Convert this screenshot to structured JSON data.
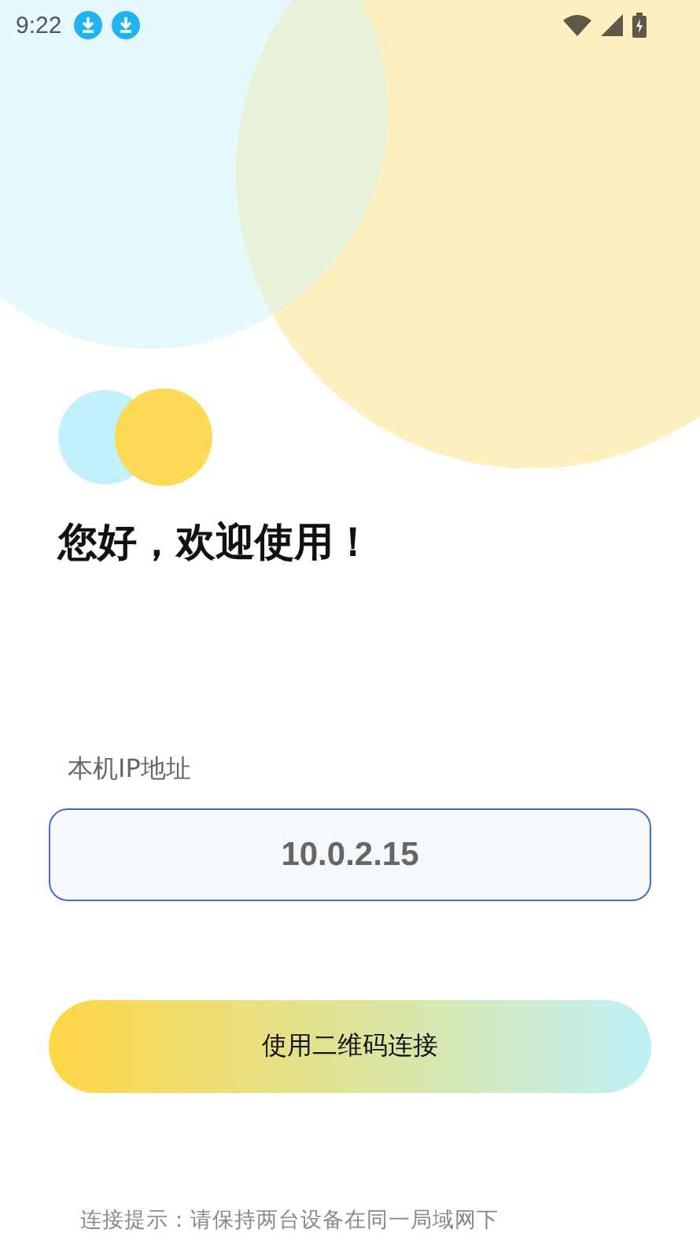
{
  "status_bar": {
    "time": "9:22",
    "notifications": [
      {
        "kind": "download"
      },
      {
        "kind": "download"
      }
    ]
  },
  "greeting": "您好，欢迎使用！",
  "ip_field": {
    "label": "本机IP地址",
    "value": "10.0.2.15"
  },
  "connect_button": {
    "label": "使用二维码连接"
  },
  "hint": "连接提示：请保持两台设备在同一局域网下"
}
